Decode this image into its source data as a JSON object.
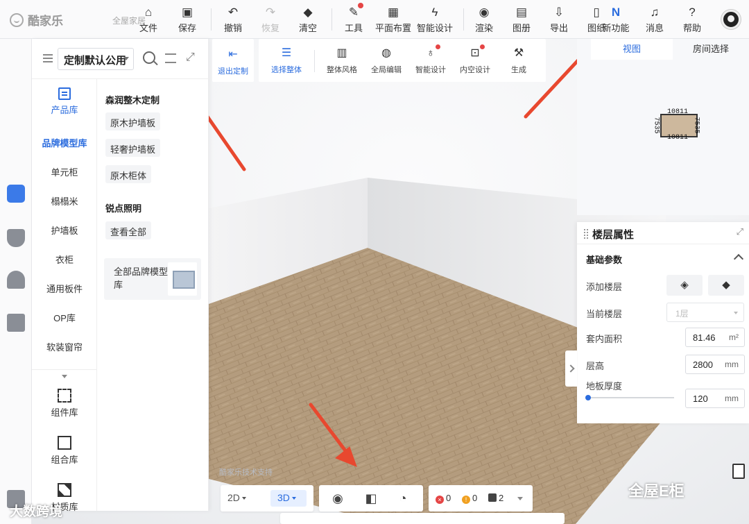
{
  "app": {
    "logo": "酷家乐",
    "project_name": "全屋家居"
  },
  "toolbar": [
    {
      "id": "file",
      "label": "文件",
      "icon": "home-icon"
    },
    {
      "id": "save",
      "label": "保存",
      "icon": "save-icon"
    },
    {
      "id": "undo",
      "label": "撤销",
      "icon": "undo-icon"
    },
    {
      "id": "redo",
      "label": "恢复",
      "icon": "redo-icon",
      "disabled": true
    },
    {
      "id": "clear",
      "label": "清空",
      "icon": "eraser-icon"
    },
    {
      "id": "tools",
      "label": "工具",
      "icon": "wrench-icon",
      "dot": true
    },
    {
      "id": "layout",
      "label": "平面布置",
      "icon": "layout-icon"
    },
    {
      "id": "smart",
      "label": "智能设计",
      "icon": "lightning-icon"
    },
    {
      "id": "render",
      "label": "渲染",
      "icon": "camera-icon"
    },
    {
      "id": "album",
      "label": "图册",
      "icon": "image-icon"
    },
    {
      "id": "export",
      "label": "导出",
      "icon": "export-icon"
    },
    {
      "id": "drawing",
      "label": "图纸",
      "icon": "document-icon"
    },
    {
      "id": "newfeat",
      "label": "新功能",
      "icon": "new-badge-icon"
    },
    {
      "id": "msg",
      "label": "消息",
      "icon": "bell-icon"
    },
    {
      "id": "help",
      "label": "帮助",
      "icon": "help-icon"
    }
  ],
  "left_panel": {
    "select_value": "定制默认公用",
    "category_header": "产品库",
    "categories": [
      "品牌模型库",
      "单元柜",
      "榻榻米",
      "护墙板",
      "衣柜",
      "通用板件",
      "OP库",
      "软装窗帘"
    ],
    "bottom_items": [
      "组件库",
      "组合库",
      "材质库"
    ],
    "groups": [
      {
        "title": "森润整木定制",
        "chips": [
          "原木护墙板",
          "轻奢护墙板",
          "原木柜体"
        ]
      },
      {
        "title": "锐点照明",
        "chips": [
          "查看全部"
        ]
      }
    ],
    "card_label": "全部品牌模型库"
  },
  "secondary_toolbar": {
    "exit_label": "退出定制",
    "buttons": [
      {
        "label": "选择整体",
        "active": true
      },
      {
        "label": "整体风格"
      },
      {
        "label": "全局编辑"
      },
      {
        "label": "智能设计",
        "dot": true
      },
      {
        "label": "内空设计",
        "dot": true
      },
      {
        "label": "生成"
      }
    ]
  },
  "view_panel": {
    "tabs": [
      "视图",
      "房间选择"
    ],
    "dim_horizontal": "10811",
    "dim_vertical": "7535"
  },
  "properties": {
    "title": "楼层属性",
    "section": "基础参数",
    "add_floor_label": "添加楼层",
    "current_floor_label": "当前楼层",
    "current_floor_value": "1层",
    "inner_area_label": "套内面积",
    "inner_area_value": "81.46",
    "inner_area_unit": "m²",
    "floor_height_label": "层高",
    "floor_height_value": "2800",
    "floor_height_unit": "mm",
    "slab_label": "地板厚度",
    "slab_value": "120",
    "slab_unit": "mm"
  },
  "bottom_bar": {
    "mode_2d": "2D",
    "mode_3d": "3D",
    "errors": "0",
    "warnings": "0",
    "items": "2"
  },
  "overlay": {
    "tech_support": "酷家乐技术支持",
    "watermark_right": "全屋E柜",
    "watermark_left": "大数跨境"
  },
  "colors": {
    "accent": "#2b6cde",
    "floor": "#b59d80",
    "arrow": "#e8482f"
  }
}
